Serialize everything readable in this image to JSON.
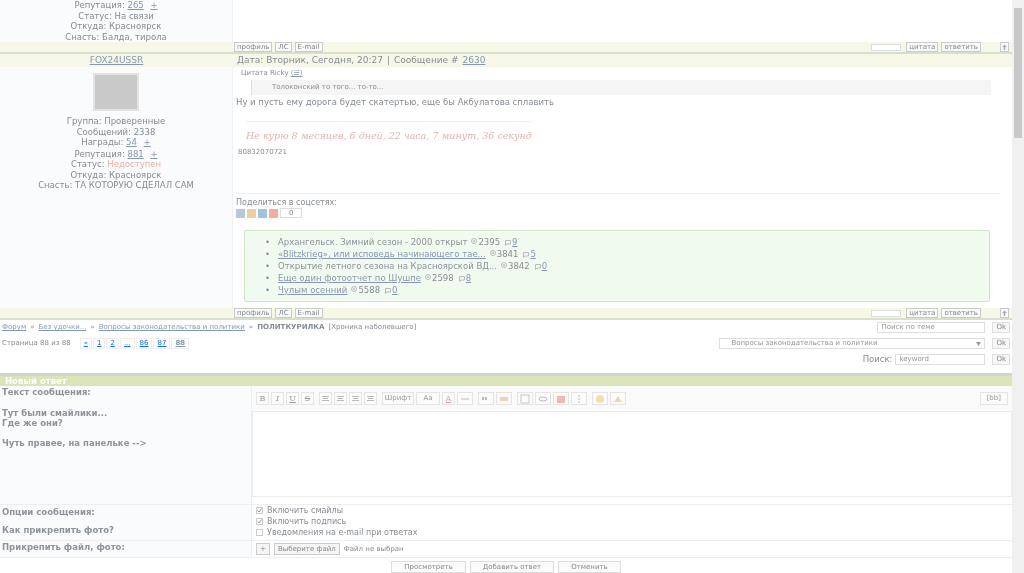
{
  "previous_post": {
    "profile": [
      {
        "label": "Репутация:",
        "value": "265",
        "kind": "link",
        "plus": "+"
      },
      {
        "label": "Статус:",
        "value": "На связи",
        "kind": "plain"
      },
      {
        "label": "Откуда:",
        "value": "Красноярск",
        "kind": "plain"
      },
      {
        "label": "Снасть:",
        "value": "Балда, тирола",
        "kind": "plain"
      }
    ]
  },
  "bar_top": {
    "left": [
      "профиль",
      "ЛС",
      "E-mail"
    ],
    "right": [
      "цитата",
      "ответить"
    ]
  },
  "post": {
    "author": "FOX24USSR",
    "date": "Дата: Вторник, Сегодня, 20:27",
    "separator": "|",
    "message_label": "Сообщение #",
    "message_number": "2630",
    "profile": [
      {
        "label": "Группа:",
        "value": "Проверенные",
        "kind": "plain"
      },
      {
        "label": "Сообщений:",
        "value": "2338",
        "kind": "plain"
      },
      {
        "label": "Награды:",
        "value": "54",
        "kind": "link",
        "plus": "+"
      },
      {
        "label": "Репутация:",
        "value": "881",
        "kind": "link",
        "plus": "+"
      },
      {
        "label": "Статус:",
        "value": "Недоступен",
        "kind": "alert"
      },
      {
        "label": "Откуда:",
        "value": "Красноярск",
        "kind": "plain"
      },
      {
        "label": "Снасть:",
        "value": "ТА КОТОРУЮ СДЕЛАЛ САМ",
        "kind": "plain"
      }
    ],
    "quote": {
      "title": "Цитата",
      "author": "Ricky",
      "ref": "(☰)",
      "text": "Толоконский то того... то-то..."
    },
    "text": "Ну и пусть ему дорога будет скатертью, еще бы Акбулатова сплавить",
    "signature": "Не курю  8 месяцев, 6 дней, 22 часа, 7 минут, 36 секунд",
    "signature_note": "80832070721",
    "share_label": "Поделиться в соцсетях:",
    "share_count": "0",
    "bullet": "•",
    "related": [
      {
        "title": "Архангельск. Зимний сезон - 2000 открыт",
        "link": false,
        "views": "2395",
        "comments": "9"
      },
      {
        "title": "«Blitzkrieg», или исповедь начинающего тае...",
        "link": true,
        "views": "3841",
        "comments": "5"
      },
      {
        "title": "Открытие летного сезона на Красноярской ВД...",
        "link": false,
        "views": "3842",
        "comments": "0"
      },
      {
        "title": "Еще один фотоотчет по Шушпе",
        "link": true,
        "views": "2598",
        "comments": "8"
      },
      {
        "title": "Чулым осенний",
        "link": true,
        "views": "5588",
        "comments": "0"
      }
    ]
  },
  "bar_bottom": {
    "left": [
      "профиль",
      "ЛС",
      "E-mail"
    ],
    "right": [
      "цитата",
      "ответить"
    ]
  },
  "breadcrumbs": {
    "separator": "»",
    "items": [
      {
        "text": "Форум",
        "link": true
      },
      {
        "text": "Без удочки...",
        "link": true
      },
      {
        "text": "Вопросы законодательства и политики",
        "link": true
      },
      {
        "text": "ПОЛИТКУРИЛКА",
        "link": false
      }
    ],
    "note": "[Хроника наболевшего]"
  },
  "topic_search": {
    "placeholder": "Поиск по теме",
    "button": "Ok"
  },
  "pagination": {
    "label": "Страница 88 из 88",
    "prev": "«",
    "pages": [
      {
        "text": "1",
        "selected": false
      },
      {
        "text": "2",
        "selected": false
      },
      {
        "text": "...",
        "selected": false
      },
      {
        "text": "86",
        "selected": false
      },
      {
        "text": "87",
        "selected": false
      },
      {
        "text": "88",
        "selected": true
      }
    ]
  },
  "forum_jump": {
    "value": "Вопросы законодательства и политики",
    "button": "Ok"
  },
  "search": {
    "label": "Поиск:",
    "placeholder": "keyword",
    "button": "Ok"
  },
  "reply_form": {
    "title": "Новый ответ",
    "message_label": "Текст сообщения:",
    "hints": [
      "Тут были смайлики...",
      "Где же они?",
      "Чуть правее, на панельке -->"
    ],
    "toolbar": {
      "format": [
        "B",
        "I",
        "U",
        "S"
      ],
      "font": "Шрифт",
      "size": "Aa",
      "text_color": "A",
      "bb": "[bb]"
    },
    "options_label": "Опции сообщения:",
    "photo_help": "Как прикрепить фото?",
    "options": [
      {
        "label": "Включить смайлы",
        "checked": true
      },
      {
        "label": "Включить подпись",
        "checked": true
      },
      {
        "label": "Уведомления на e-mail при ответах",
        "checked": false
      }
    ],
    "attach_label": "Прикрепить файл, фото:",
    "add_file": "+",
    "choose_file": "Выберите файл",
    "no_file": "Файл не выбран",
    "buttons": [
      "Просмотреть",
      "Добавить ответ",
      "Отменить"
    ]
  }
}
